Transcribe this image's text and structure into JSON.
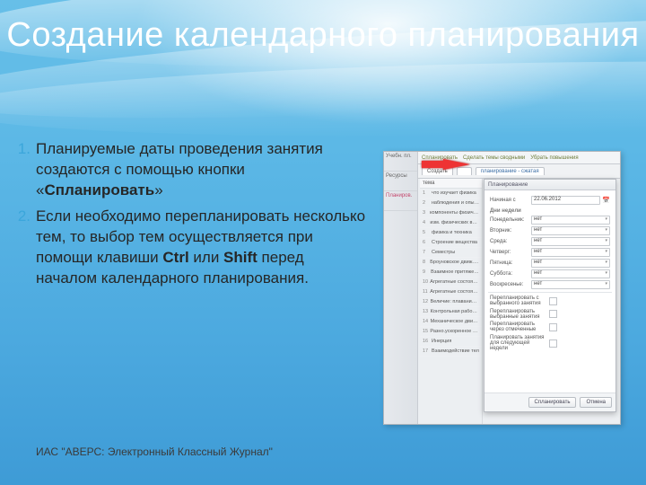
{
  "slide": {
    "title": "Создание календарного планирования",
    "footer": "ИАС \"АВЕРС: Электронный Классный Журнал\"",
    "bullets": [
      {
        "num": "1.",
        "html": "Планируемые даты проведения занятия создаются с помощью кнопки «<strong>Спланировать</strong>»"
      },
      {
        "num": "2.",
        "html": "Если необходимо перепланировать несколько тем, то выбор тем осуществляется при помощи клавиши  <strong>Ctrl</strong> или <strong>Shift</strong> перед началом календарного планирования."
      }
    ]
  },
  "screenshot": {
    "sidebar": [
      "Учебн. пл.",
      "Ресурсы",
      "Планиров."
    ],
    "toolbar": [
      "Спланировать",
      "Сделать темы сводными",
      "Убрать повышения"
    ],
    "tabs": [
      "Создать",
      "",
      "планирование - сжатая"
    ],
    "list_header": "тема",
    "list_rows": [
      "что изучает физика",
      "наблюдения и опыты",
      "компоненты физич. вели...",
      "изм. физических величин",
      "физика и техника",
      "Строение вещества",
      "Семестры",
      "Броуновское движ. Диф...",
      "Взаимное притяжени...",
      "Агрегатные состояния в...",
      "Агрегатные состояния в...",
      "Величие: плавание тел...",
      "Контрольная работа №2",
      "Механическое движение",
      "Разно.ускоренное движ...",
      "Инерция",
      "Взаимодействие тел"
    ],
    "dialog": {
      "title": "Планирование",
      "start_label": "Начиная с",
      "start_value": "22.06.2012",
      "days_header": "Дни недели",
      "days": [
        {
          "name": "Понедельник:",
          "val": "нет"
        },
        {
          "name": "Вторник:",
          "val": "нет"
        },
        {
          "name": "Среда:",
          "val": "нет"
        },
        {
          "name": "Четверг:",
          "val": "нет"
        },
        {
          "name": "Пятница:",
          "val": "нет"
        },
        {
          "name": "Суббота:",
          "val": "нет"
        },
        {
          "name": "Воскресенье:",
          "val": "нет"
        }
      ],
      "checks": [
        "Перепланировать с выбранного занятия",
        "Перепланировать выбранные занятия",
        "Перепланировать через отмеченные",
        "Планировать занятия для следующей недели"
      ],
      "ok": "Спланировать",
      "cancel": "Отмена"
    }
  }
}
